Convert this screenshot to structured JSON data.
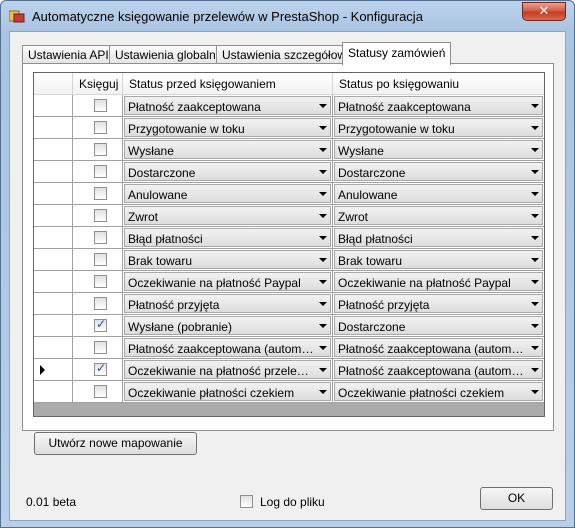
{
  "window": {
    "title": "Automatyczne księgowanie przelewów w PrestaShop - Konfiguracja",
    "close_glyph": "✕"
  },
  "tabs": [
    {
      "label": "Ustawienia API",
      "active": false
    },
    {
      "label": "Ustawienia globalne",
      "active": false
    },
    {
      "label": "Ustawienia szczegółowe",
      "active": false
    },
    {
      "label": "Statusy zamówień",
      "active": true
    }
  ],
  "grid": {
    "columns": {
      "check": "Księguj",
      "before": "Status przed księgowaniem",
      "after": "Status po księgowaniu"
    },
    "current_row_index": 12,
    "rows": [
      {
        "checked": false,
        "before": "Płatność zaakceptowana",
        "after": "Płatność zaakceptowana"
      },
      {
        "checked": false,
        "before": "Przygotowanie w toku",
        "after": "Przygotowanie w toku"
      },
      {
        "checked": false,
        "before": "Wysłane",
        "after": "Wysłane"
      },
      {
        "checked": false,
        "before": "Dostarczone",
        "after": "Dostarczone"
      },
      {
        "checked": false,
        "before": "Anulowane",
        "after": "Anulowane"
      },
      {
        "checked": false,
        "before": "Zwrot",
        "after": "Zwrot"
      },
      {
        "checked": false,
        "before": "Błąd płatności",
        "after": "Błąd płatności"
      },
      {
        "checked": false,
        "before": "Brak towaru",
        "after": "Brak towaru"
      },
      {
        "checked": false,
        "before": "Oczekiwanie na płatność Paypal",
        "after": "Oczekiwanie na płatność Paypal"
      },
      {
        "checked": false,
        "before": "Płatność przyjęta",
        "after": "Płatność przyjęta"
      },
      {
        "checked": true,
        "before": "Wysłane (pobranie)",
        "after": "Dostarczone"
      },
      {
        "checked": false,
        "before": "Płatność zaakceptowana (automaty...",
        "after": "Płatność zaakceptowana (automaty..."
      },
      {
        "checked": true,
        "before": "Oczekiwanie na płatność przelewem...",
        "after": "Płatność zaakceptowana (automaty..."
      },
      {
        "checked": false,
        "before": "Oczekiwanie płatności czekiem",
        "after": "Oczekiwanie płatności czekiem"
      }
    ]
  },
  "buttons": {
    "create_mapping": "Utwórz nowe mapowanie",
    "ok": "OK"
  },
  "footer": {
    "version": "0.01 beta",
    "log_label": "Log do pliku",
    "log_checked": false
  }
}
